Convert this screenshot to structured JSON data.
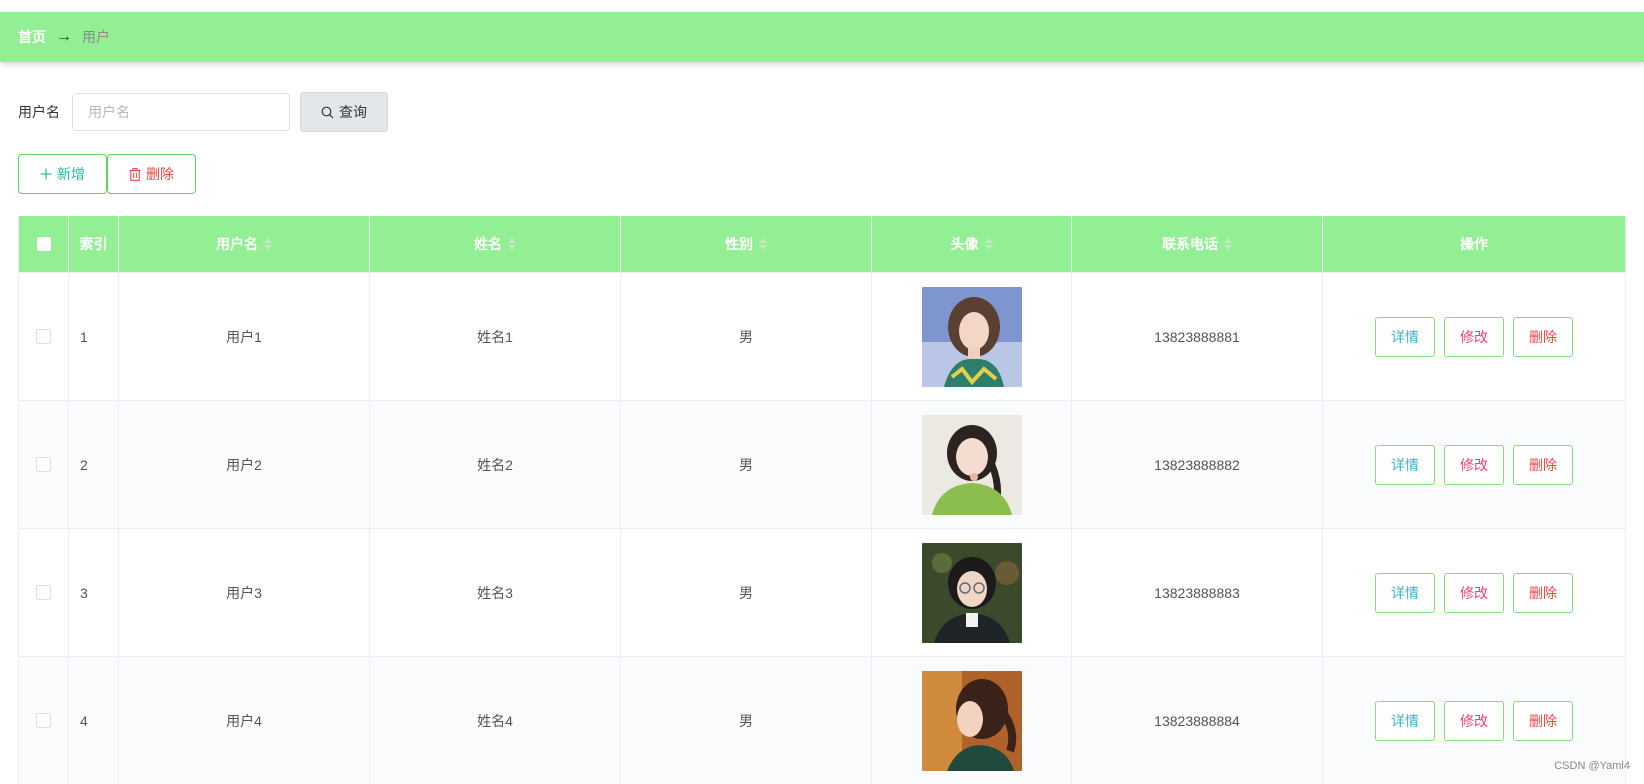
{
  "breadcrumb": {
    "home": "首页",
    "separator": "→",
    "current": "用户"
  },
  "search": {
    "label": "用户名",
    "placeholder": "用户名",
    "value": "",
    "button_label": "查询"
  },
  "actions": {
    "add_label": "新增",
    "delete_label": "删除"
  },
  "table": {
    "columns": [
      "索引",
      "用户名",
      "姓名",
      "性别",
      "头像",
      "联系电话",
      "操作"
    ],
    "rows": [
      {
        "index": "1",
        "username": "用户1",
        "name": "姓名1",
        "gender": "男",
        "phone": "13823888881",
        "avatar": "avatar-photo-1"
      },
      {
        "index": "2",
        "username": "用户2",
        "name": "姓名2",
        "gender": "男",
        "phone": "13823888882",
        "avatar": "avatar-photo-2"
      },
      {
        "index": "3",
        "username": "用户3",
        "name": "姓名3",
        "gender": "男",
        "phone": "13823888883",
        "avatar": "avatar-photo-3"
      },
      {
        "index": "4",
        "username": "用户4",
        "name": "姓名4",
        "gender": "男",
        "phone": "13823888884",
        "avatar": "avatar-photo-4"
      }
    ],
    "row_actions": {
      "detail": "详情",
      "edit": "修改",
      "remove": "删除"
    }
  },
  "colors": {
    "header_green": "#93ef93",
    "button_border": "#5fd35f",
    "detail": "#3fb4c9",
    "edit": "#ee3f7a",
    "danger": "#ee4444"
  },
  "watermark": "CSDN @Yaml4"
}
